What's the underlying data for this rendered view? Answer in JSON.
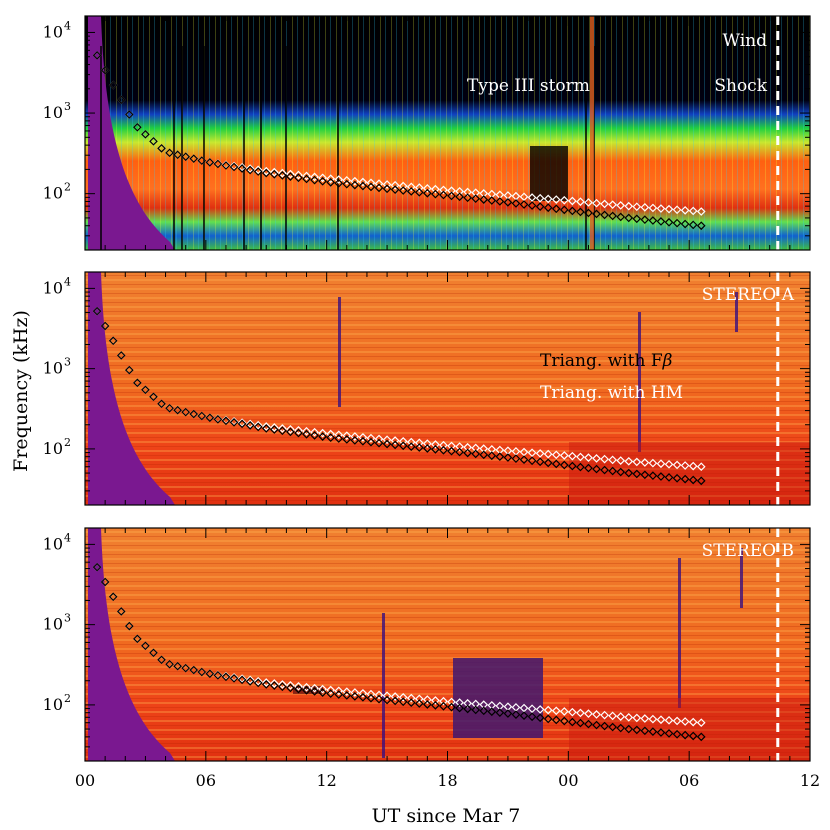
{
  "figure": {
    "ylabel": "Frequency (kHz)",
    "xlabel": "UT since Mar 7"
  },
  "chart_data": {
    "type": "heatmap",
    "x_unit": "UT hours from 2012-03-07 00:00",
    "xlim": [
      0,
      36
    ],
    "x_ticks": [
      0,
      6,
      12,
      18,
      24,
      30,
      36
    ],
    "x_tick_labels": [
      "00",
      "06",
      "12",
      "18",
      "00",
      "06",
      "12"
    ],
    "y_scale": "log",
    "ylim": [
      20,
      16000
    ],
    "y_ticks": [
      100,
      1000,
      10000
    ],
    "y_tick_labels": [
      "10",
      "10",
      "10"
    ],
    "y_tick_exponents": [
      "2",
      "3",
      "4"
    ],
    "shock_time_hours": 34.4,
    "triangulation_series": [
      {
        "legend_label": "Triang. with Fβ",
        "color": "#ffffff",
        "x": [
          0.6,
          1.5,
          2.5,
          4,
          6,
          9,
          12,
          15,
          18,
          21,
          24,
          27,
          30.6
        ],
        "y": [
          5200,
          2000,
          700,
          330,
          250,
          190,
          155,
          130,
          110,
          95,
          82,
          70,
          60
        ]
      },
      {
        "legend_label": "Triang. with HM",
        "color": "#000000",
        "x": [
          0.6,
          1.5,
          2.5,
          4,
          6,
          9,
          12,
          15,
          18,
          21,
          24,
          27,
          30.6
        ],
        "y": [
          5200,
          2000,
          700,
          330,
          250,
          180,
          140,
          115,
          95,
          78,
          62,
          50,
          40
        ]
      }
    ],
    "panels": [
      {
        "id": "wind",
        "spacecraft_label": "Wind",
        "annotations": {
          "storm": "Type III storm",
          "shock": "Shock"
        }
      },
      {
        "id": "stereo-a",
        "spacecraft_label": "STEREO A",
        "legend": {
          "f_beta_prefix": "Triang. with F",
          "f_beta_symbol": "β",
          "hm": "Triang. with HM"
        }
      },
      {
        "id": "stereo-b",
        "spacecraft_label": "STEREO B"
      }
    ]
  }
}
